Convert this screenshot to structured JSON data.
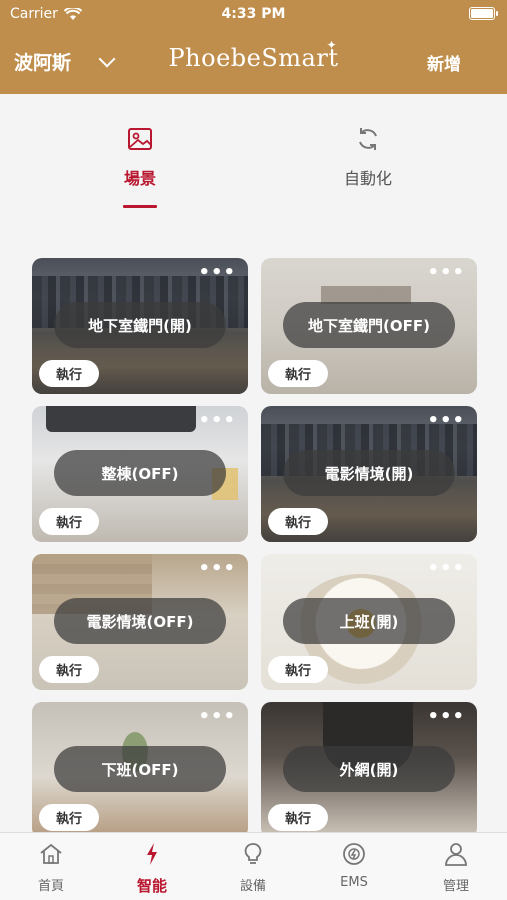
{
  "status_bar": {
    "carrier": "Carrier",
    "time": "4:33 PM"
  },
  "header": {
    "location": "波阿斯",
    "logo": "PhoebeSmart",
    "add_label": "新增"
  },
  "mode_tabs": [
    {
      "label": "場景",
      "icon": "image-icon",
      "active": true
    },
    {
      "label": "自動化",
      "icon": "refresh-icon",
      "active": false
    }
  ],
  "scenes": [
    {
      "name": "地下室鐵門(開)",
      "run_label": "執行",
      "more": "•••",
      "image": "city-skyline"
    },
    {
      "name": "地下室鐵門(OFF)",
      "run_label": "執行",
      "more": "•••",
      "image": "kitchen"
    },
    {
      "name": "整棟(OFF)",
      "run_label": "執行",
      "more": "•••",
      "image": "laptop-desk"
    },
    {
      "name": "電影情境(開)",
      "run_label": "執行",
      "more": "•••",
      "image": "city-skyline"
    },
    {
      "name": "電影情境(OFF)",
      "run_label": "執行",
      "more": "•••",
      "image": "living-room"
    },
    {
      "name": "上班(開)",
      "run_label": "執行",
      "more": "•••",
      "image": "breakfast"
    },
    {
      "name": "下班(OFF)",
      "run_label": "執行",
      "more": "•••",
      "image": "bedroom"
    },
    {
      "name": "外網(開)",
      "run_label": "執行",
      "more": "•••",
      "image": "baker"
    }
  ],
  "tab_bar": [
    {
      "label": "首頁",
      "icon": "home-icon",
      "active": false
    },
    {
      "label": "智能",
      "icon": "lightning-icon",
      "active": true
    },
    {
      "label": "設備",
      "icon": "lightbulb-icon",
      "active": false
    },
    {
      "label": "EMS",
      "icon": "meter-icon",
      "active": false
    },
    {
      "label": "管理",
      "icon": "user-icon",
      "active": false
    }
  ],
  "colors": {
    "brand_gold": "#c08e4c",
    "accent_red": "#b9162f"
  }
}
